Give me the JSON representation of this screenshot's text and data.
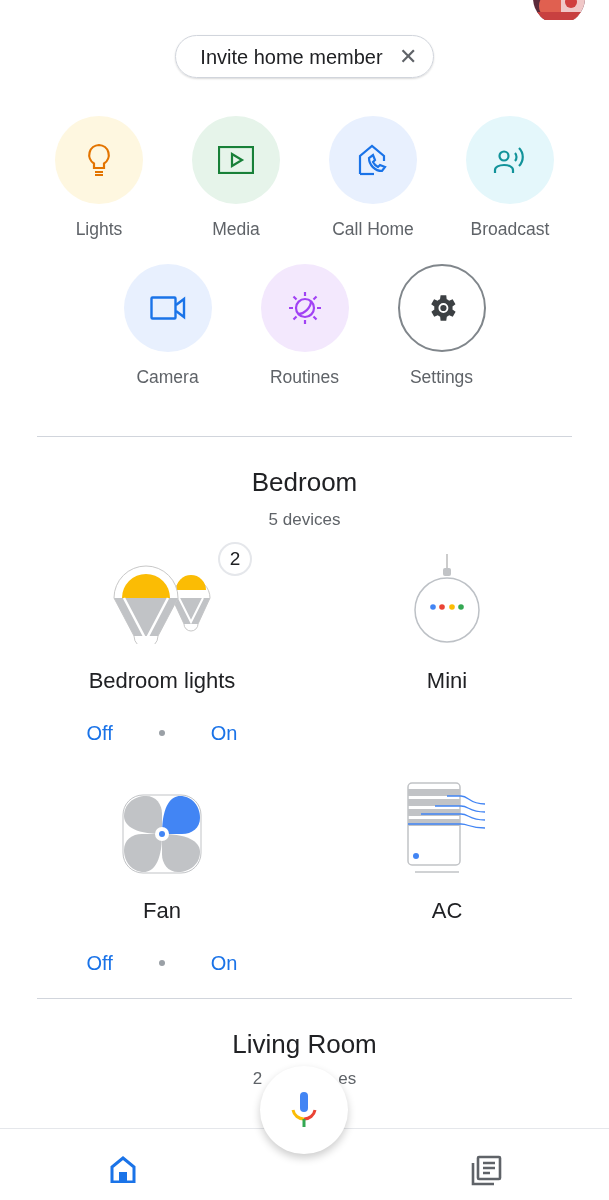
{
  "invite_chip": {
    "label": "Invite home member",
    "close": "✕"
  },
  "actions": [
    {
      "kind": "lights",
      "label": "Lights"
    },
    {
      "kind": "media",
      "label": "Media"
    },
    {
      "kind": "call",
      "label": "Call Home"
    },
    {
      "kind": "broadcast",
      "label": "Broadcast"
    },
    {
      "kind": "camera",
      "label": "Camera"
    },
    {
      "kind": "routines",
      "label": "Routines"
    },
    {
      "kind": "settings",
      "label": "Settings"
    }
  ],
  "rooms": [
    {
      "title": "Bedroom",
      "subtitle": [
        "5 devices"
      ],
      "devices": [
        {
          "kind": "bulbs",
          "name": "Bedroom lights",
          "badge": "2",
          "controls": [
            "Off",
            "On"
          ]
        },
        {
          "kind": "mini",
          "name": "Mini"
        },
        {
          "kind": "fan",
          "name": "Fan",
          "controls": [
            "Off",
            "On"
          ]
        },
        {
          "kind": "ac",
          "name": "AC"
        }
      ]
    },
    {
      "title": "Living Room",
      "subtitle": [
        "2",
        "es"
      ]
    }
  ],
  "bottom_nav": [
    {
      "kind": "home",
      "selected": true
    },
    {
      "kind": "feed",
      "selected": false
    }
  ]
}
